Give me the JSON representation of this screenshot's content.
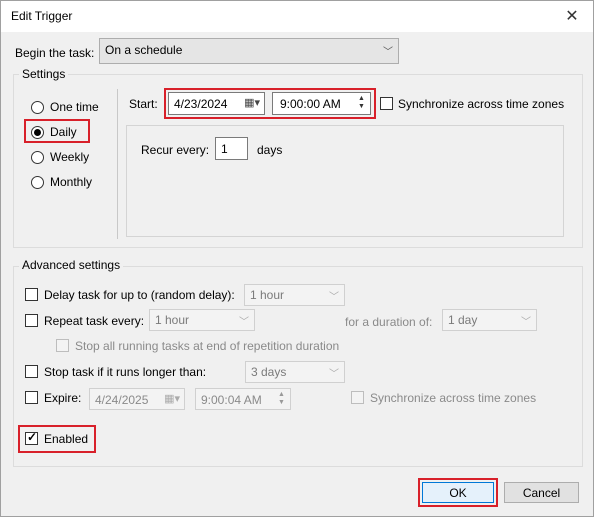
{
  "window": {
    "title": "Edit Trigger",
    "close_glyph": "✕"
  },
  "begin_task": {
    "label": "Begin the task:",
    "value": "On a schedule"
  },
  "settings": {
    "group_label": "Settings",
    "options": [
      "One time",
      "Daily",
      "Weekly",
      "Monthly"
    ],
    "selected": "Daily",
    "start_label": "Start:",
    "start_date": "4/23/2024",
    "start_time": "9:00:00 AM",
    "sync_label": "Synchronize across time zones",
    "recur_label": "Recur every:",
    "recur_value": "1",
    "recur_unit": "days"
  },
  "advanced": {
    "group_label": "Advanced settings",
    "delay_label": "Delay task for up to (random delay):",
    "delay_value": "1 hour",
    "repeat_label": "Repeat task every:",
    "repeat_value": "1 hour",
    "duration_label": "for a duration of:",
    "duration_value": "1 day",
    "stop_running_label": "Stop all running tasks at end of repetition duration",
    "stop_longer_label": "Stop task if it runs longer than:",
    "stop_longer_value": "3 days",
    "expire_label": "Expire:",
    "expire_date": "4/24/2025",
    "expire_time": "9:00:04 AM",
    "expire_sync_label": "Synchronize across time zones",
    "enabled_label": "Enabled"
  },
  "buttons": {
    "ok": "OK",
    "cancel": "Cancel"
  }
}
